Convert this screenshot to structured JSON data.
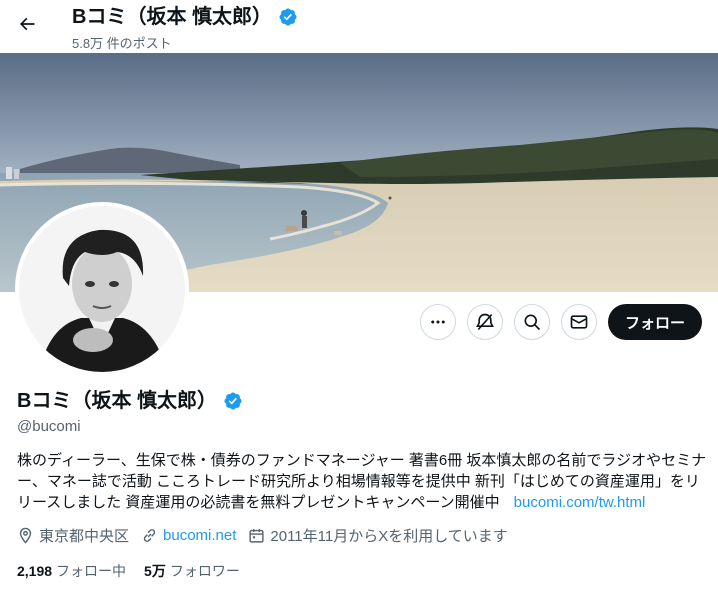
{
  "header": {
    "name": "Bコミ（坂本 慎太郎）",
    "post_count": "5.8万 件のポスト",
    "back_icon": "arrow-left-icon"
  },
  "profile": {
    "name": "Bコミ（坂本 慎太郎）",
    "handle": "@bucomi",
    "bio": "株のディーラー、生保で株・債券のファンドマネージャー 著書6冊 坂本慎太郎の名前でラジオやセミナー、マネー誌で活動 こころトレード研究所より相場情報等を提供中 新刊「はじめての資産運用」をリリースしました 資産運用の必読書を無料プレゼントキャンペーン開催中",
    "bio_link": "bucomi.com/tw.html",
    "location": "東京都中央区",
    "website": "bucomi.net",
    "joined": "2011年11月からXを利用しています",
    "following_count": "2,198",
    "following_label": "フォロー中",
    "followers_count": "5万",
    "followers_label": "フォロワー"
  },
  "actions": {
    "more_icon": "more-icon",
    "subscribe_icon": "notification-bell-icon",
    "search_icon": "search-icon",
    "message_icon": "mail-icon",
    "follow_label": "フォロー"
  },
  "colors": {
    "accent": "#1d9bf0",
    "text": "#0f1419",
    "muted": "#536471",
    "follow_button": "#0f1419"
  }
}
